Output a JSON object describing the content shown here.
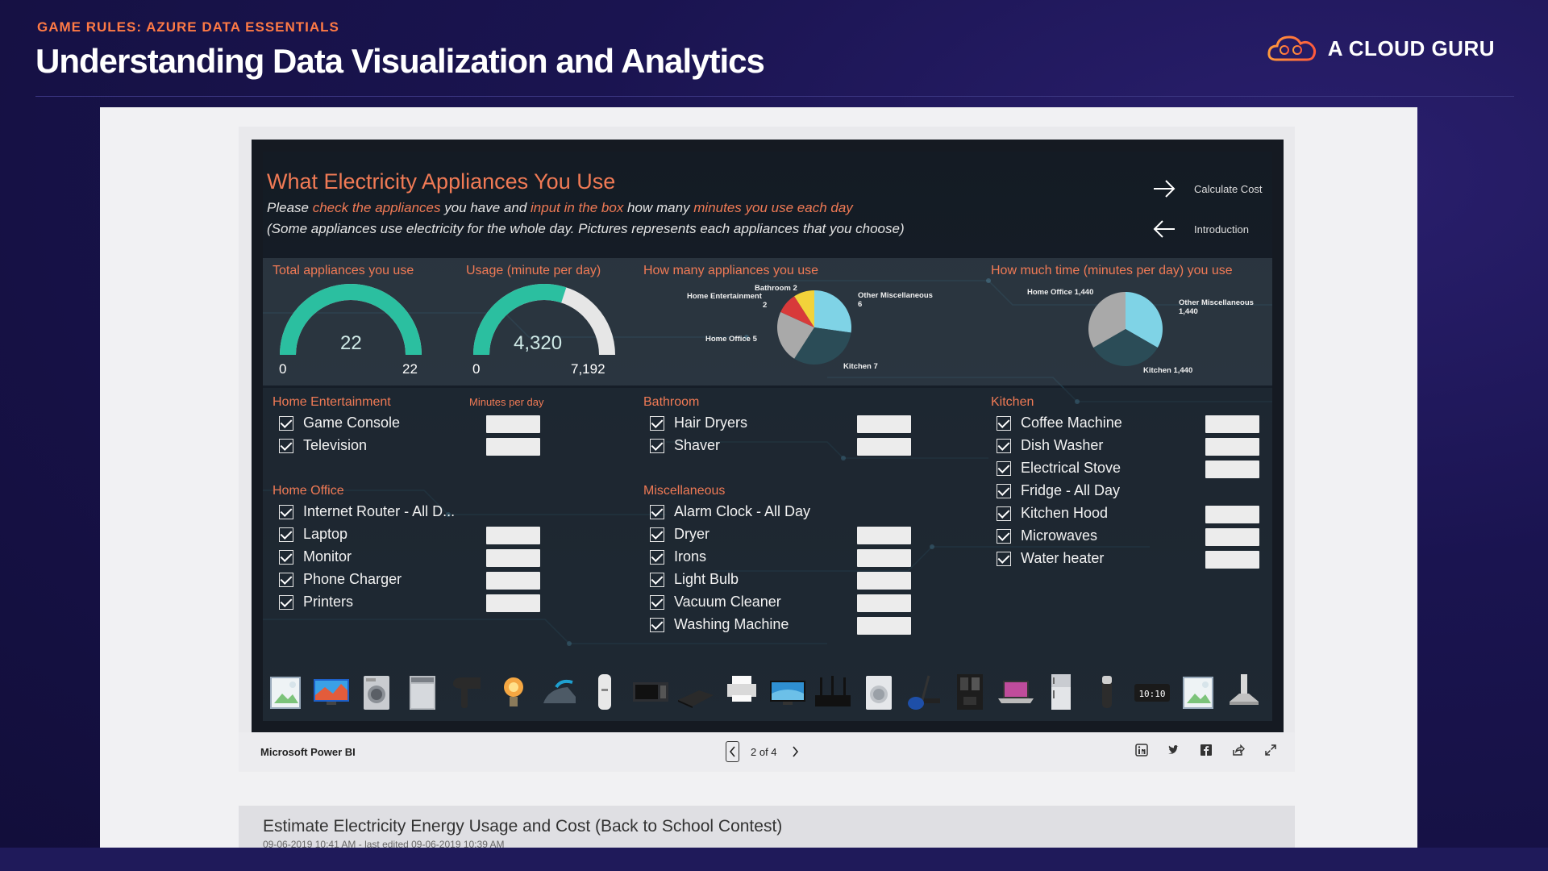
{
  "slide": {
    "eyebrow": "GAME RULES: AZURE DATA ESSENTIALS",
    "title": "Understanding Data Visualization and Analytics",
    "brand": "A CLOUD GURU"
  },
  "report": {
    "title": "What Electricity Appliances You Use",
    "subtitle1": {
      "a": "Please ",
      "b": "check the appliances",
      "c": " you have and ",
      "d": "input in the box",
      "e": " how many ",
      "f": "minutes you use each day"
    },
    "subtitle2": "(Some appliances use electricity for the whole day. Pictures represents each appliances that you choose)",
    "nav_next": "Calculate Cost",
    "nav_prev": "Introduction",
    "gauges": [
      {
        "title": "Total appliances you use",
        "value": "22",
        "min": "0",
        "max": "22",
        "fraction": 1.0
      },
      {
        "title": "Usage (minute per day)",
        "value": "4,320",
        "min": "0",
        "max": "7,192",
        "fraction": 0.6007
      }
    ],
    "pie1": {
      "title": "How many appliances you use",
      "labels": {
        "bathroom": "Bathroom 2",
        "home_ent": "Home Entertainment",
        "home_ent_val": "2",
        "other_misc": "Other Miscellaneous",
        "other_misc_val": "6",
        "home_office": "Home Office 5",
        "kitchen": "Kitchen 7"
      },
      "slices": [
        {
          "name": "Other Miscellaneous",
          "value": 6,
          "color": "#7fd3e6"
        },
        {
          "name": "Kitchen",
          "value": 7,
          "color": "#2b4c57"
        },
        {
          "name": "Home Office",
          "value": 5,
          "color": "#a9a9a9"
        },
        {
          "name": "Home Entertainment",
          "value": 2,
          "color": "#d83a3a"
        },
        {
          "name": "Bathroom",
          "value": 2,
          "color": "#f2d33a"
        }
      ]
    },
    "pie2": {
      "title": "How much time (minutes per day) you use",
      "labels": {
        "home_office": "Home Office 1,440",
        "other_misc": "Other Miscellaneous",
        "other_misc_val": "1,440",
        "kitchen": "Kitchen 1,440"
      },
      "slices": [
        {
          "name": "Other Miscellaneous",
          "value": 1440,
          "color": "#7fd3e6"
        },
        {
          "name": "Kitchen",
          "value": 1440,
          "color": "#2b4c57"
        },
        {
          "name": "Home Office",
          "value": 1440,
          "color": "#a9a9a9"
        }
      ]
    },
    "minutes_label": "Minutes per day",
    "groups": {
      "home_ent": {
        "title": "Home Entertainment",
        "items": [
          "Game Console",
          "Television"
        ]
      },
      "home_office": {
        "title": "Home Office",
        "items": [
          "Internet Router - All D...",
          "Laptop",
          "Monitor",
          "Phone Charger",
          "Printers"
        ]
      },
      "bathroom": {
        "title": "Bathroom",
        "items": [
          "Hair Dryers",
          "Shaver"
        ]
      },
      "misc": {
        "title": "Miscellaneous",
        "items": [
          "Alarm Clock - All Day",
          "Dryer",
          "Irons",
          "Light Bulb",
          "Vacuum Cleaner",
          "Washing Machine"
        ]
      },
      "kitchen": {
        "title": "Kitchen",
        "items": [
          "Coffee Machine",
          "Dish Washer",
          "Electrical Stove",
          "Fridge - All Day",
          "Kitchen Hood",
          "Microwaves",
          "Water heater"
        ]
      }
    },
    "appliance_icons": [
      "image-placeholder-icon",
      "television-icon",
      "washing-machine-icon",
      "dishwasher-icon",
      "hair-dryer-icon",
      "light-bulb-icon",
      "iron-icon",
      "water-heater-icon",
      "microwave-icon",
      "game-console-icon",
      "printer-icon",
      "monitor-icon",
      "router-icon",
      "dryer-icon",
      "vacuum-cleaner-icon",
      "coffee-machine-icon",
      "laptop-icon",
      "fridge-icon",
      "shaver-icon",
      "alarm-clock-icon",
      "image-placeholder-icon",
      "kitchen-hood-icon"
    ]
  },
  "footer": {
    "app": "Microsoft Power BI",
    "page": "2 of 4"
  },
  "caption": {
    "title": "Estimate Electricity Energy Usage and Cost (Back to School Contest)",
    "meta": "09-06-2019 10:41 AM - last edited 09-06-2019 10:39 AM"
  }
}
